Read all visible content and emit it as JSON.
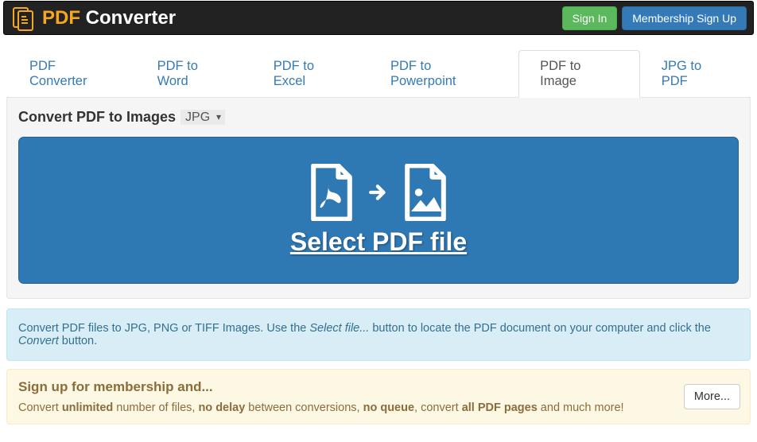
{
  "header": {
    "brand_orange": "PDF",
    "brand_white": "Converter",
    "signin_label": "Sign In",
    "membership_label": "Membership Sign Up"
  },
  "tabs": [
    {
      "label": "PDF Converter",
      "active": false
    },
    {
      "label": "PDF to Word",
      "active": false
    },
    {
      "label": "PDF to Excel",
      "active": false
    },
    {
      "label": "PDF to Powerpoint",
      "active": false
    },
    {
      "label": "PDF to Image",
      "active": true
    },
    {
      "label": "JPG to PDF",
      "active": false
    }
  ],
  "panel": {
    "title": "Convert PDF to Images",
    "format_selected": "JPG",
    "dropzone_label": "Select PDF file"
  },
  "info": {
    "t1": "Convert PDF files to JPG, PNG or TIFF Images. Use the ",
    "i1": "Select file...",
    "t2": " button to locate the PDF document on your computer and click the ",
    "i2": "Convert",
    "t3": " button."
  },
  "promo": {
    "heading": "Sign up for membership and...",
    "p1": "Convert ",
    "b1": "unlimited",
    "p2": " number of files, ",
    "b2": "no delay",
    "p3": " between conversions, ",
    "b3": "no queue",
    "p4": ", convert ",
    "b4": "all PDF pages",
    "p5": " and much more!",
    "more_label": "More..."
  }
}
